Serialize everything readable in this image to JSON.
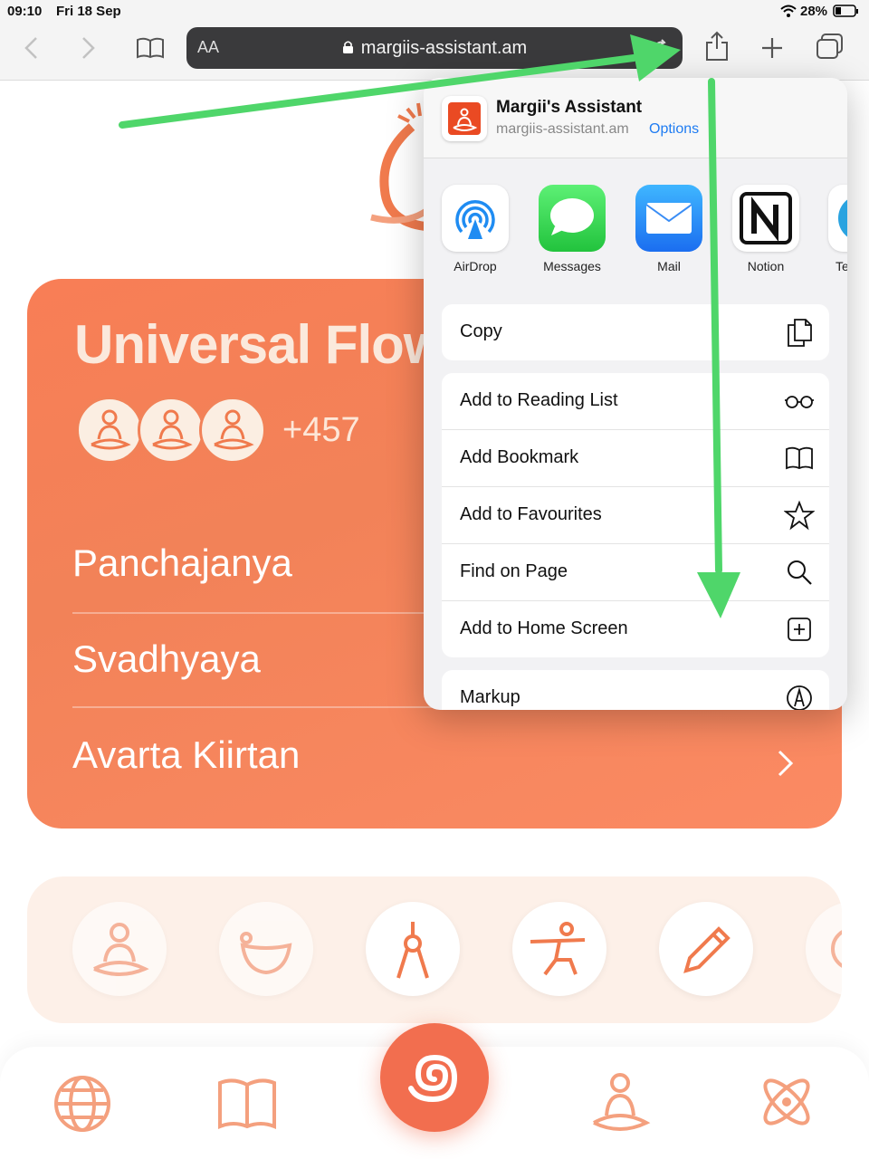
{
  "status": {
    "time": "09:10",
    "date": "Fri 18 Sep",
    "battery": "28%"
  },
  "browser": {
    "text_size_label": "AA",
    "url": "margiis-assistant.am"
  },
  "page": {
    "card_title": "Universal Flow",
    "participants_count": "+457",
    "menu_items": [
      "Panchajanya",
      "Svadhyaya",
      "Avarta Kiirtan"
    ]
  },
  "share_sheet": {
    "app_name": "Margii's Assistant",
    "app_url": "margiis-assistant.am",
    "options_label": "Options",
    "apps": [
      {
        "label": "AirDrop",
        "icon": "airdrop-icon"
      },
      {
        "label": "Messages",
        "icon": "messages-icon"
      },
      {
        "label": "Mail",
        "icon": "mail-icon"
      },
      {
        "label": "Notion",
        "icon": "notion-icon"
      },
      {
        "label": "Te",
        "icon": "telegram-icon"
      }
    ],
    "actions": [
      {
        "label": "Copy",
        "icon": "copy-icon"
      },
      {
        "label": "Add to Reading List",
        "icon": "glasses-icon"
      },
      {
        "label": "Add Bookmark",
        "icon": "book-icon"
      },
      {
        "label": "Add to Favourites",
        "icon": "star-icon"
      },
      {
        "label": "Find on Page",
        "icon": "search-icon"
      },
      {
        "label": "Add to Home Screen",
        "icon": "plus-square-icon"
      },
      {
        "label": "Markup",
        "icon": "markup-icon"
      }
    ]
  },
  "colors": {
    "accent": "#f26e4f",
    "card": "#f28258",
    "link_blue": "#1f7cf2",
    "arrow_green": "#4fd66a"
  }
}
